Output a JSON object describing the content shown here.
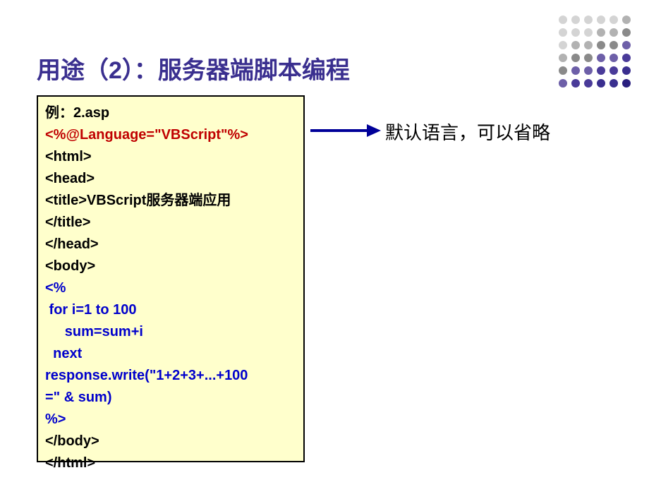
{
  "title": "用途（2）：服务器端脚本编程",
  "code": {
    "ex_label": "例：2.asp",
    "lang_directive": "<%@Language=\"VBScript\"%>",
    "html_open": "<html>",
    "head_open": "<head>",
    "title_line": "<title>VBScript服务器端应用",
    "title_close": "</title>",
    "head_close": "</head>",
    "body_open": "<body>",
    "asp_open": "<%",
    "for_line": " for i=1 to 100",
    "sum_line": "     sum=sum+i",
    "next_line": "  next",
    "resp_line1": "response.write(\"1+2+3+...+100",
    "resp_line2": "=\" & sum)",
    "asp_close": "%>",
    "body_close": "</body>",
    "html_close": "</html>"
  },
  "annotation": "默认语言，可以省略",
  "dot_colors": {
    "d00": "#d4d4d4",
    "d01": "#d4d4d4",
    "d02": "#d4d4d4",
    "d03": "#d4d4d4",
    "d04": "#d4d4d4",
    "d05": "#b2b2b2",
    "d10": "#d4d4d4",
    "d11": "#d4d4d4",
    "d12": "#d4d4d4",
    "d13": "#b2b2b2",
    "d14": "#b2b2b2",
    "d15": "#8a8a8a",
    "d20": "#d4d4d4",
    "d21": "#b2b2b2",
    "d22": "#b2b2b2",
    "d23": "#8a8a8a",
    "d24": "#8a8a8a",
    "d25": "#6d5fa8",
    "d30": "#b2b2b2",
    "d31": "#8a8a8a",
    "d32": "#8a8a8a",
    "d33": "#6d5fa8",
    "d34": "#6d5fa8",
    "d35": "#4a3b99",
    "d40": "#8a8a8a",
    "d41": "#6d5fa8",
    "d42": "#6d5fa8",
    "d43": "#4a3b99",
    "d44": "#4a3b99",
    "d45": "#3a2f8f",
    "d50": "#6d5fa8",
    "d51": "#4a3b99",
    "d52": "#4a3b99",
    "d53": "#3a2f8f",
    "d54": "#3a2f8f",
    "d55": "#2a1f7f"
  }
}
